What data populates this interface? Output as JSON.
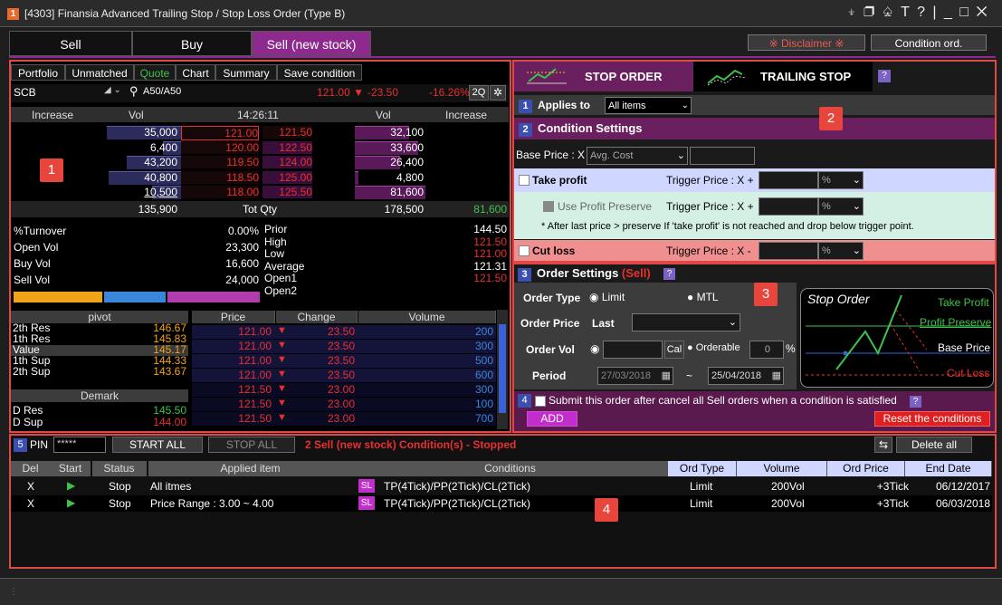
{
  "window": {
    "badge": "1",
    "title": "[4303] Finansia Advanced Trailing Stop / Stop Loss Order (Type B)",
    "controls": "⍖ ❐ ♤ T ? | _ □ ✕"
  },
  "tabs": [
    "Sell",
    "Buy",
    "Sell (new stock)"
  ],
  "header_buttons": {
    "disclaimer": "※ Disclaimer ※",
    "condition": "Condition ord."
  },
  "left": {
    "subtabs": [
      "Portfolio",
      "Unmatched",
      "Quote",
      "Chart",
      "Summary",
      "Save condition"
    ],
    "symbol": "SCB",
    "ticker": "A50/A50",
    "last": "121.00 ▼",
    "chg": "-23.50",
    "pct": "-16.26%",
    "btn2q": "2Q",
    "book_headers": [
      "Increase",
      "Vol",
      "14:26:11",
      "Vol",
      "Increase"
    ],
    "bids": [
      [
        "35,000",
        "121.00"
      ],
      [
        "6,400",
        "120.00"
      ],
      [
        "43,200",
        "119.50"
      ],
      [
        "40,800",
        "118.50"
      ],
      [
        "10,500",
        "118.00"
      ]
    ],
    "asks": [
      [
        "121.50",
        "32,100"
      ],
      [
        "122.50",
        "33,600"
      ],
      [
        "124.00",
        "26,400"
      ],
      [
        "125.00",
        "4,800"
      ],
      [
        "125.50",
        "81,600"
      ]
    ],
    "totals": {
      "bid": "135,900",
      "label": "Tot Qty",
      "ask": "178,500",
      "inc": "81,600"
    },
    "stats": [
      [
        "%Turnover",
        "0.00%"
      ],
      [
        "Open Vol",
        "23,300"
      ],
      [
        "Buy Vol",
        "16,600"
      ],
      [
        "Sell Vol",
        "24,000"
      ]
    ],
    "prices_labels": [
      "Prior",
      "High",
      "Low",
      "Average",
      "Open1",
      "Open2"
    ],
    "prices_values": [
      "144.50",
      "121.50",
      "121.00",
      "121.31",
      "121.50",
      ""
    ],
    "pivot_header": "pivot",
    "pivot": [
      [
        "2th Res",
        "146.67"
      ],
      [
        "1th Res",
        "145.83"
      ],
      [
        "Value",
        "145.17"
      ],
      [
        "1th Sup",
        "144.33"
      ],
      [
        "2th Sup",
        "143.67"
      ]
    ],
    "demark_header": "Demark",
    "demark": [
      [
        "D Res",
        "145.50"
      ],
      [
        "D Sup",
        "144.00"
      ]
    ],
    "trade_headers": [
      "Price",
      "Change",
      "Volume"
    ],
    "trades": [
      [
        "121.00",
        "23.50",
        "200"
      ],
      [
        "121.00",
        "23.50",
        "300"
      ],
      [
        "121.00",
        "23.50",
        "500"
      ],
      [
        "121.00",
        "23.50",
        "600"
      ],
      [
        "121.50",
        "23.00",
        "300"
      ],
      [
        "121.50",
        "23.00",
        "100"
      ],
      [
        "121.50",
        "23.00",
        "700"
      ]
    ]
  },
  "right": {
    "stop_order": "STOP ORDER",
    "trailing_stop": "TRAILING STOP",
    "help": "?",
    "applies_to": {
      "num": "1",
      "label": "Applies to",
      "value": "All items"
    },
    "condition": {
      "num": "2",
      "title": "Condition Settings",
      "base_label": "Base Price : X",
      "base_value": "Avg. Cost",
      "take_profit": "Take profit",
      "trigger_plus": "Trigger Price : X +",
      "use_pp": "Use Profit Preserve",
      "note": "* After last price > preserve If 'take profit' is not reached and drop below trigger point.",
      "cut_loss": "Cut loss",
      "trigger_minus": "Trigger Price : X -",
      "pct": "%"
    },
    "order": {
      "num": "3",
      "title": "Order Settings",
      "sell": "(Sell)",
      "order_type": "Order Type",
      "limit": "Limit",
      "mtl": "MTL",
      "order_price": "Order Price",
      "last": "Last",
      "order_vol": "Order Vol",
      "cal": "Cal",
      "orderable": "Orderable",
      "orderable_val": "0",
      "pct": "%",
      "period": "Period",
      "date_from": "27/03/2018",
      "tilde": "~",
      "date_to": "25/04/2018"
    },
    "diagram": {
      "title": "Stop Order",
      "take_profit": "Take Profit",
      "profit_preserve": "Profit Preserve",
      "base_price": "Base Price",
      "cut_loss": "Cut Loss"
    },
    "submit": {
      "num": "4",
      "text": "Submit this order after cancel all Sell orders when a condition is satisfied",
      "add": "ADD",
      "reset": "Reset the conditions"
    }
  },
  "bottom": {
    "num": "5",
    "pin": "PIN",
    "pin_value": "*****",
    "start_all": "START ALL",
    "stop_all": "STOP ALL",
    "status": "2 Sell (new stock) Condition(s) -  Stopped",
    "delete_all": "Delete all",
    "headers": [
      "Del",
      "Start",
      "Status",
      "Applied item",
      "Conditions",
      "Ord Type",
      "Volume",
      "Ord Price",
      "End Date"
    ],
    "rows": [
      {
        "del": "X",
        "status": "Stop",
        "item": "All itmes",
        "sl": "SL",
        "cond": "TP(4Tick)/PP(2Tick)/CL(2Tick)",
        "type": "Limit",
        "vol": "200Vol",
        "price": "+3Tick",
        "date": "06/12/2017"
      },
      {
        "del": "X",
        "status": "Stop",
        "item": "Price Range : 3.00 ~ 4.00",
        "sl": "SL",
        "cond": "TP(4Tick)/PP(2Tick)/CL(2Tick)",
        "type": "Limit",
        "vol": "200Vol",
        "price": "+3Tick",
        "date": "06/03/2018"
      }
    ]
  },
  "callouts": [
    "1",
    "2",
    "3",
    "4"
  ],
  "colors": {
    "accent": "#8e2a8e",
    "red": "#e83030",
    "green": "#3fc24b",
    "blue": "#3a62d8"
  }
}
